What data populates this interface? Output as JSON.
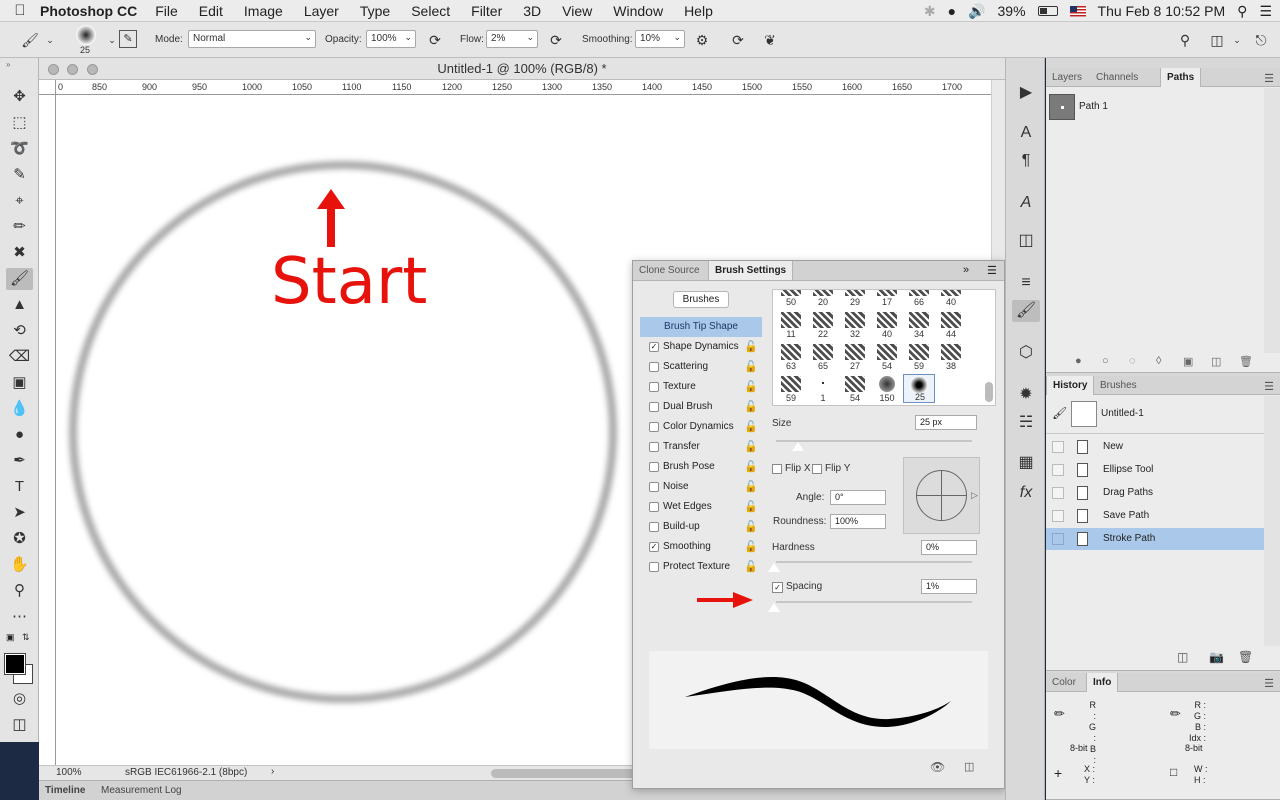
{
  "menubar": {
    "app_name": "Photoshop CC",
    "items": [
      "File",
      "Edit",
      "Image",
      "Layer",
      "Type",
      "Select",
      "Filter",
      "3D",
      "View",
      "Window",
      "Help"
    ],
    "battery": "39%",
    "datetime": "Thu Feb 8  10:52 PM"
  },
  "options_bar": {
    "brush_size": "25",
    "mode_label": "Mode:",
    "mode_value": "Normal",
    "opacity_label": "Opacity:",
    "opacity_value": "100%",
    "flow_label": "Flow:",
    "flow_value": "2%",
    "smoothing_label": "Smoothing:",
    "smoothing_value": "10%"
  },
  "document": {
    "title": "Untitled-1 @ 100% (RGB/8) *",
    "ruler_ticks": [
      "0",
      "850",
      "900",
      "950",
      "1000",
      "1050",
      "1100",
      "1150",
      "1200",
      "1250",
      "1300",
      "1350",
      "1400",
      "1450",
      "1500",
      "1550",
      "1600",
      "1650",
      "1700"
    ],
    "annotation": "Start",
    "zoom": "100%",
    "color_profile": "sRGB IEC61966-2.1 (8bpc)"
  },
  "bottom_tabs": [
    "Timeline",
    "Measurement Log"
  ],
  "brush_panel": {
    "tabs": [
      "Clone Source",
      "Brush Settings"
    ],
    "brushes_button": "Brushes",
    "options": [
      {
        "label": "Brush Tip Shape",
        "checked": null
      },
      {
        "label": "Shape Dynamics",
        "checked": true
      },
      {
        "label": "Scattering",
        "checked": false
      },
      {
        "label": "Texture",
        "checked": false
      },
      {
        "label": "Dual Brush",
        "checked": false
      },
      {
        "label": "Color Dynamics",
        "checked": false
      },
      {
        "label": "Transfer",
        "checked": false
      },
      {
        "label": "Brush Pose",
        "checked": false
      },
      {
        "label": "Noise",
        "checked": false
      },
      {
        "label": "Wet Edges",
        "checked": false
      },
      {
        "label": "Build-up",
        "checked": false
      },
      {
        "label": "Smoothing",
        "checked": true
      },
      {
        "label": "Protect Texture",
        "checked": false
      }
    ],
    "tip_sizes": [
      [
        "50",
        "20",
        "29",
        "17",
        "66",
        "40"
      ],
      [
        "11",
        "22",
        "32",
        "40",
        "34",
        "44"
      ],
      [
        "63",
        "65",
        "27",
        "54",
        "59",
        "38"
      ],
      [
        "59",
        "1",
        "54",
        "150",
        "25"
      ]
    ],
    "size_label": "Size",
    "size_value": "25 px",
    "flip_x": "Flip X",
    "flip_y": "Flip Y",
    "angle_label": "Angle:",
    "angle_value": "0°",
    "roundness_label": "Roundness:",
    "roundness_value": "100%",
    "hardness_label": "Hardness",
    "hardness_value": "0%",
    "spacing_label": "Spacing",
    "spacing_value": "1%",
    "spacing_checked": true
  },
  "layers_panel": {
    "tabs": [
      "Layers",
      "Channels",
      "Paths"
    ],
    "path_name": "Path 1"
  },
  "history_panel": {
    "tabs": [
      "History",
      "Brushes"
    ],
    "snapshot": "Untitled-1",
    "states": [
      "New",
      "Ellipse Tool",
      "Drag Paths",
      "Save Path",
      "Stroke Path"
    ],
    "selected_state": "Stroke Path"
  },
  "info_panel": {
    "tabs": [
      "Color",
      "Info"
    ],
    "rgb_left": [
      "R :",
      "G :",
      "B :"
    ],
    "rgb_right": [
      "R :",
      "G :",
      "B :",
      "Idx :"
    ],
    "bit_left": "8-bit",
    "bit_right": "8-bit",
    "xy": [
      "X :",
      "Y :"
    ],
    "wh": [
      "W :",
      "H :"
    ]
  },
  "colors": {
    "annotation_red": "#e8120c",
    "selection_blue": "#a9c8ea"
  }
}
